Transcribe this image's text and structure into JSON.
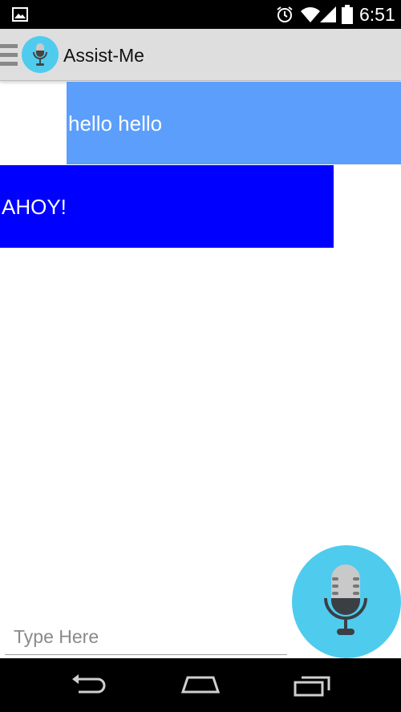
{
  "status_bar": {
    "time": "6:51",
    "icons": [
      "gallery-icon",
      "alarm-icon",
      "wifi-icon",
      "signal-icon",
      "battery-icon"
    ]
  },
  "action_bar": {
    "title": "Assist-Me",
    "icons": [
      "drawer-icon",
      "microphone-logo-icon"
    ]
  },
  "messages": [
    {
      "text": "hello hello",
      "color": "#5b9efc"
    },
    {
      "text": "AHOY!",
      "color": "#0000ff"
    }
  ],
  "input": {
    "placeholder": "Type Here",
    "value": ""
  },
  "mic_button": {
    "icon": "microphone-icon",
    "color": "#4fcbee"
  },
  "nav_bar": {
    "icons": [
      "back-icon",
      "home-icon",
      "recents-icon"
    ]
  }
}
